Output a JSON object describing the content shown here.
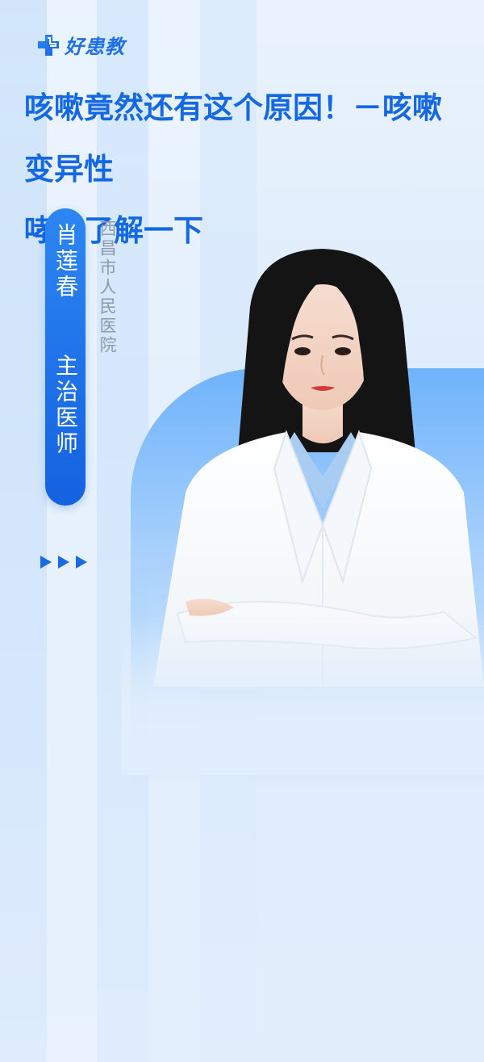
{
  "brand": {
    "logo_text": "好患教",
    "accent_color": "#1468e3"
  },
  "article": {
    "title_line1": "咳嗽竟然还有这个原因！－咳嗽变异性",
    "title_line2": "哮喘了解一下"
  },
  "doctor": {
    "name": "肖莲春",
    "title": "主治医师",
    "hospital": "西昌市人民医院",
    "portrait_icon": "doctor-portrait"
  },
  "decor": {
    "arrow_icon": "play-arrow-icon"
  }
}
